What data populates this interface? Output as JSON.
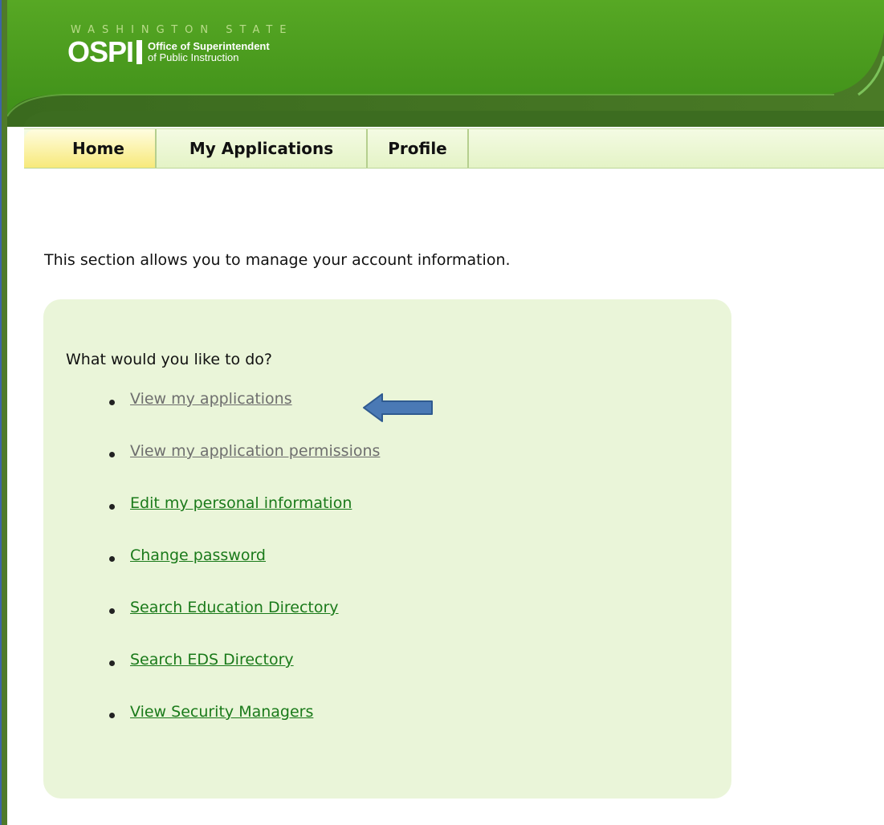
{
  "header": {
    "state_label": "WASHINGTON STATE",
    "agency_abbrev": "OSPI",
    "agency_line1": "Office of Superintendent",
    "agency_line2": "of Public Instruction"
  },
  "tabs": [
    {
      "label": "Home",
      "active": true
    },
    {
      "label": "My Applications",
      "active": false
    },
    {
      "label": "Profile",
      "active": false
    }
  ],
  "main": {
    "intro": "This section allows you to manage your account information.",
    "question": "What would you like to do?",
    "actions": [
      {
        "label": "View my applications",
        "visited": true
      },
      {
        "label": "View my application permissions",
        "visited": true
      },
      {
        "label": "Edit my personal information",
        "visited": false
      },
      {
        "label": "Change password",
        "visited": false
      },
      {
        "label": "Search Education Directory",
        "visited": false
      },
      {
        "label": "Search EDS Directory",
        "visited": false
      },
      {
        "label": "View Security Managers",
        "visited": false
      }
    ]
  },
  "colors": {
    "header_green": "#4c9a1e",
    "header_dark": "#3f6e22",
    "tab_active": "#f7e97a",
    "panel_bg": "#eaf5d9",
    "link": "#1a7a1a",
    "link_visited": "#6e6e6e",
    "arrow_fill": "#4a79b5"
  },
  "icons": {
    "pointer": "left-arrow-icon"
  }
}
